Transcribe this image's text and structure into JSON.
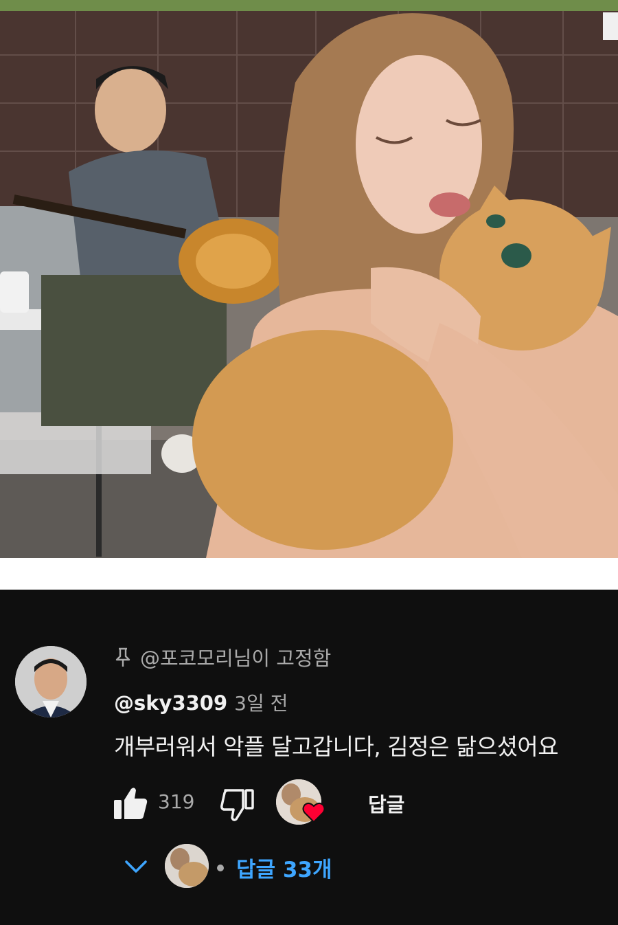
{
  "video": {
    "description_name": "video-still"
  },
  "comment": {
    "pinned_label": "@포코모리님이 고정함",
    "username": "@sky3309",
    "timestamp": "3일 전",
    "text": "개부러워서 악플 달고갑니다, 김정은 닮으셨어요",
    "like_count": "319",
    "reply_label": "답글",
    "replies_label": "답글 33개"
  },
  "colors": {
    "panel_bg": "#0f0f0f",
    "primary_text": "#f1f1f1",
    "secondary_text": "#aaaaaa",
    "link_blue": "#3ea6ff",
    "heart_red": "#ff0033"
  },
  "icons": {
    "pin": "pin-icon",
    "like": "thumbs-up-icon",
    "dislike": "thumbs-down-icon",
    "heart": "heart-icon",
    "expand": "chevron-down-icon"
  }
}
